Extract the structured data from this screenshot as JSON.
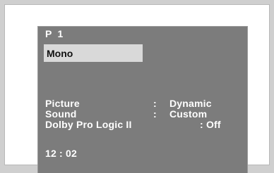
{
  "osd": {
    "program": "P  1",
    "sound_mode": "Mono",
    "rows": [
      {
        "label": "Picture",
        "colon": ":",
        "value": "Dynamic"
      },
      {
        "label": "Sound",
        "colon": ":",
        "value": "Custom"
      },
      {
        "label": "Dolby Pro Logic II",
        "value": ": Off"
      }
    ],
    "clock": "12 : 02"
  },
  "colors": {
    "page_background": "#cfcfcf",
    "frame_background": "#ffffff",
    "screen_background": "#7c7c7c",
    "highlight_background": "#d9d9d9",
    "osd_text": "#ffffff",
    "highlight_text": "#111111"
  }
}
